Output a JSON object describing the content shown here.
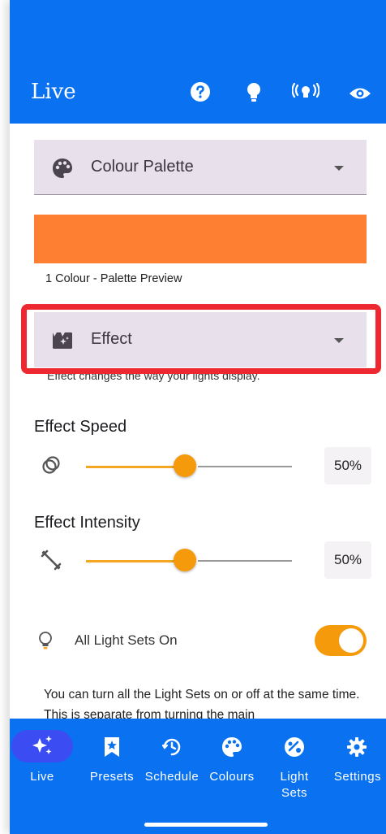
{
  "header": {
    "title": "Live",
    "icons": [
      "help-icon",
      "bulb-icon",
      "broadcast-icon",
      "eye-icon"
    ]
  },
  "palette": {
    "label": "Colour Palette",
    "preview_caption": "1 Colour - Palette Preview",
    "preview_color": "#ff7f32"
  },
  "effect": {
    "label": "Effect",
    "caption": "Effect changes the way your lights display."
  },
  "effect_speed": {
    "title": "Effect Speed",
    "value_text": "50%",
    "value": 0.5
  },
  "effect_intensity": {
    "title": "Effect Intensity",
    "value_text": "50%",
    "value": 0.5
  },
  "light_sets": {
    "label": "All Light Sets On",
    "on": true,
    "help": "You can turn all the Light Sets on or off at the same time. This is separate from turning the main"
  },
  "nav": {
    "items": [
      {
        "label": "Live",
        "icon": "sparkles-icon",
        "active": true
      },
      {
        "label": "Presets",
        "icon": "bookmark-star-icon",
        "active": false
      },
      {
        "label": "Schedule",
        "icon": "schedule-clock-icon",
        "active": false
      },
      {
        "label": "Colours",
        "icon": "palette-icon",
        "active": false
      },
      {
        "label": "Light Sets",
        "icon": "light-sets-icon",
        "active": false
      },
      {
        "label": "Settings",
        "icon": "gear-icon",
        "active": false
      }
    ]
  },
  "colors": {
    "primary": "#0a72f0",
    "accent": "#f59a0b",
    "highlight": "#ee2831",
    "dropdown_bg": "#e8e1ec"
  }
}
